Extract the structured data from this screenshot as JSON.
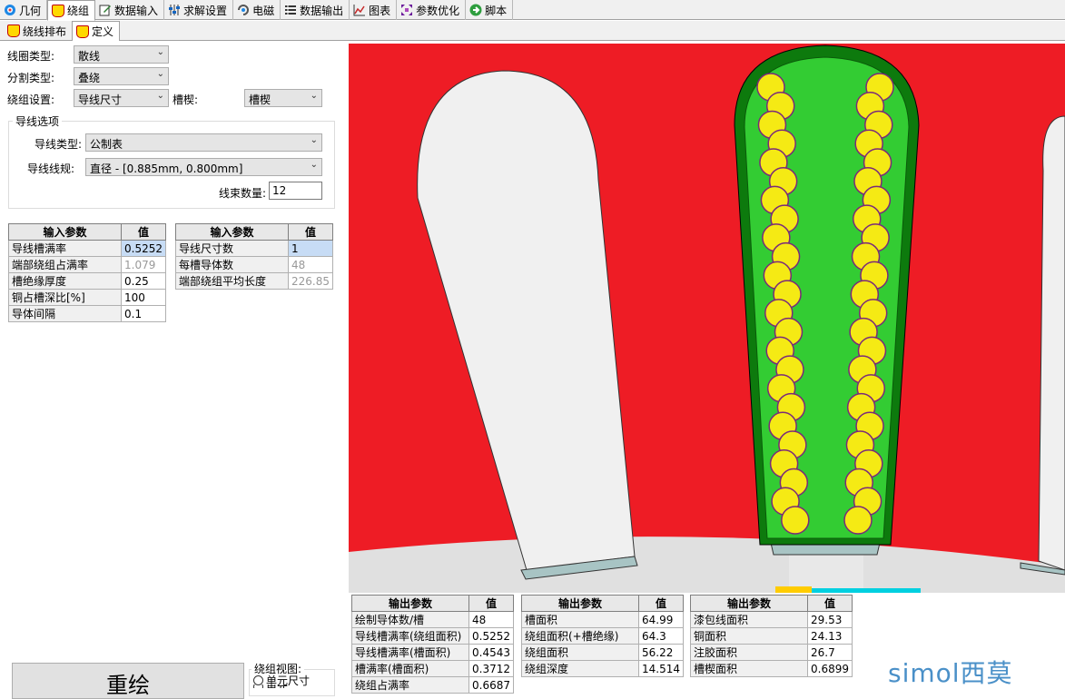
{
  "tabs": [
    {
      "label": "几何",
      "icon": "geometry-icon",
      "active": false
    },
    {
      "label": "绕组",
      "icon": "winding-icon",
      "active": true
    },
    {
      "label": "数据输入",
      "icon": "data-input-icon",
      "active": false
    },
    {
      "label": "求解设置",
      "icon": "solver-settings-icon",
      "active": false
    },
    {
      "label": "电磁",
      "icon": "electromagnetic-icon",
      "active": false
    },
    {
      "label": "数据输出",
      "icon": "data-output-icon",
      "active": false
    },
    {
      "label": "图表",
      "icon": "chart-icon",
      "active": false
    },
    {
      "label": "参数优化",
      "icon": "optimization-icon",
      "active": false
    },
    {
      "label": "脚本",
      "icon": "script-icon",
      "active": false
    }
  ],
  "subtabs": [
    {
      "label": "绕线排布",
      "active": false
    },
    {
      "label": "定义",
      "active": true
    }
  ],
  "form": {
    "coil_type_label": "线圈类型:",
    "coil_type_value": "散线",
    "split_type_label": "分割类型:",
    "split_type_value": "叠绕",
    "winding_setting_label": "绕组设置:",
    "winding_setting_value": "导线尺寸",
    "wedge_label": "槽楔:",
    "wedge_value": "槽楔",
    "wire_options_title": "导线选项",
    "wire_type_label": "导线类型:",
    "wire_type_value": "公制表",
    "wire_gauge_label": "导线线规:",
    "wire_gauge_value": "直径  -  [0.885mm, 0.800mm]",
    "strand_count_label": "线束数量:",
    "strand_count_value": "12"
  },
  "input_table_1": {
    "headers": [
      "输入参数",
      "值"
    ],
    "rows": [
      [
        "导线槽满率",
        "0.5252"
      ],
      [
        "端部绕组占满率",
        "1.079"
      ],
      [
        "槽绝缘厚度",
        "0.25"
      ],
      [
        "铜占槽深比[%]",
        "100"
      ],
      [
        "导体间隔",
        "0.1"
      ]
    ]
  },
  "input_table_2": {
    "headers": [
      "输入参数",
      "值"
    ],
    "rows": [
      [
        "导线尺寸数",
        "1"
      ],
      [
        "每槽导体数",
        "48"
      ],
      [
        "端部绕组平均长度",
        "226.85"
      ]
    ]
  },
  "redraw_label": "重绘",
  "view_group": {
    "title": "绕组视图:",
    "option1": "单元尺寸",
    "option2": "单元"
  },
  "output_table_1": {
    "headers": [
      "输出参数",
      "值"
    ],
    "rows": [
      [
        "绘制导体数/槽",
        "48"
      ],
      [
        "导线槽满率(绕组面积)",
        "0.5252"
      ],
      [
        "导线槽满率(槽面积)",
        "0.4543"
      ],
      [
        "槽满率(槽面积)",
        "0.3712"
      ],
      [
        "绕组占满率",
        "0.6687"
      ]
    ]
  },
  "output_table_2": {
    "headers": [
      "输出参数",
      "值"
    ],
    "rows": [
      [
        "槽面积",
        "64.99"
      ],
      [
        "绕组面积(+槽绝缘)",
        "64.3"
      ],
      [
        "绕组面积",
        "56.22"
      ],
      [
        "绕组深度",
        "14.514"
      ]
    ]
  },
  "output_table_3": {
    "headers": [
      "输出参数",
      "值"
    ],
    "rows": [
      [
        "漆包线面积",
        "29.53"
      ],
      [
        "铜面积",
        "24.13"
      ],
      [
        "注胶面积",
        "26.7"
      ],
      [
        "槽楔面积",
        "0.6899"
      ]
    ]
  },
  "logo_text": "simol西莫",
  "colors": {
    "stator_red": "#ee1c25",
    "winding_green": "#33cc33",
    "insulation_dark_green": "#0d7a0d",
    "conductor_yellow": "#f5ea14",
    "conductor_outline": "#7a2a7a",
    "slot_white": "#f0f0f0"
  }
}
